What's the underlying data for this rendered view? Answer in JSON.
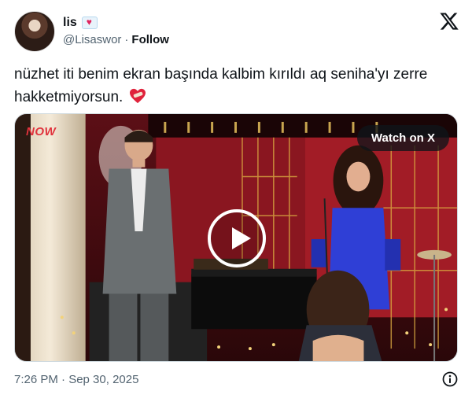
{
  "author": {
    "display_name": "lis",
    "badge_icon": "heart-envelope-icon",
    "handle": "@Lisaswor",
    "separator": "·",
    "follow_label": "Follow"
  },
  "platform_logo": "x-logo-icon",
  "tweet": {
    "text": "nüzhet iti benim ekran başında kalbim kırıldı aq seniha'yı zerre hakketmiyorsun.",
    "emoji": "heart-with-bandage-emoji"
  },
  "media": {
    "watermark": "NOW",
    "watch_label": "Watch on X",
    "play_icon": "play-icon"
  },
  "footer": {
    "timestamp": "7:26 PM · Sep 30, 2025",
    "info_icon": "info-icon"
  },
  "colors": {
    "text_primary": "#0f1419",
    "text_secondary": "#536471",
    "border": "#cfd9de",
    "stage_red": "#8a1620"
  }
}
